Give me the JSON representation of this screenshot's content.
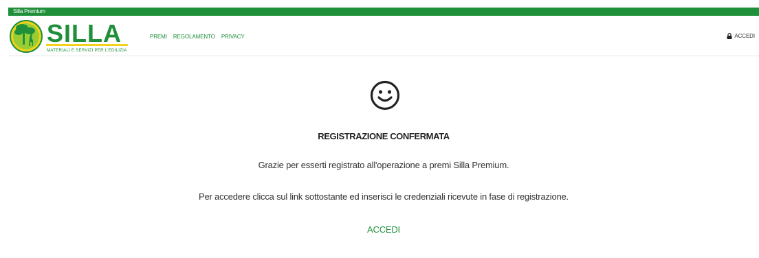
{
  "topbar": {
    "title": "Silla Premium",
    "color": "#1f8f3a"
  },
  "header": {
    "logo": {
      "name": "SILLA",
      "tagline": "MATERIALI E SERVIZI PER L'EDILIZIA"
    },
    "nav": [
      {
        "label": "PREMI"
      },
      {
        "label": "REGOLAMENTO"
      },
      {
        "label": "PRIVACY"
      }
    ],
    "login": {
      "label": "ACCEDI",
      "icon": "lock-icon"
    }
  },
  "main": {
    "icon": "smiley-icon",
    "title": "REGISTRAZIONE CONFERMATA",
    "message_1": "Grazie per esserti registrato all'operazione a premi Silla Premium.",
    "message_2": "Per accedere clicca sul link sottostante ed inserisci le credenziali ricevute in fase di registrazione.",
    "cta_label": "ACCEDI"
  },
  "colors": {
    "brand_green": "#1f8f3a",
    "brand_yellow": "#f2d21b"
  }
}
